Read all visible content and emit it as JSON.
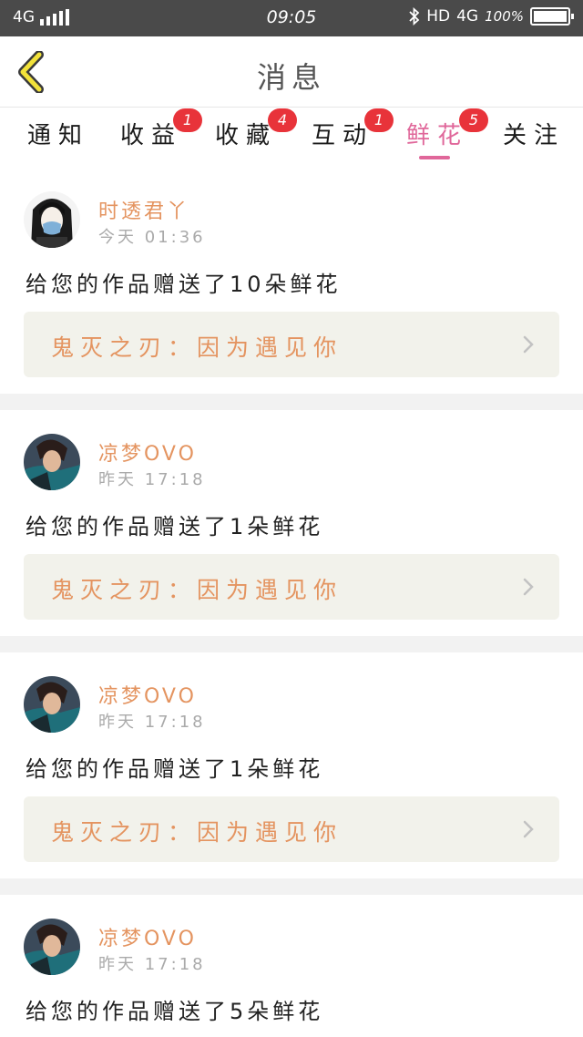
{
  "status_bar": {
    "network_left": "4G",
    "time": "09:05",
    "hd": "HD",
    "network_right": "4G",
    "battery_text": "100%",
    "battery_level": 1.0
  },
  "header": {
    "title": "消息",
    "back_icon": "chevron-left-icon"
  },
  "colors": {
    "accent_pink": "#e0679a",
    "badge_red": "#e8333a",
    "username_orange": "#e49460",
    "back_yellow": "#f2e23a"
  },
  "tabs": [
    {
      "label": "通知",
      "badge": ""
    },
    {
      "label": "收益",
      "badge": "1"
    },
    {
      "label": "收藏",
      "badge": "4"
    },
    {
      "label": "互动",
      "badge": "1"
    },
    {
      "label": "鲜花",
      "badge": "5",
      "active": true
    },
    {
      "label": "关注",
      "badge": ""
    }
  ],
  "messages": [
    {
      "username": "时透君丫",
      "time": "今天 01:36",
      "text": "给您的作品赠送了10朵鲜花",
      "work": "鬼灭之刃：因为遇见你"
    },
    {
      "username": "凉梦OVO",
      "time": "昨天 17:18",
      "text": "给您的作品赠送了1朵鲜花",
      "work": "鬼灭之刃：因为遇见你"
    },
    {
      "username": "凉梦OVO",
      "time": "昨天 17:18",
      "text": "给您的作品赠送了1朵鲜花",
      "work": "鬼灭之刃：因为遇见你"
    },
    {
      "username": "凉梦OVO",
      "time": "昨天 17:18",
      "text": "给您的作品赠送了5朵鲜花",
      "work": ""
    }
  ]
}
